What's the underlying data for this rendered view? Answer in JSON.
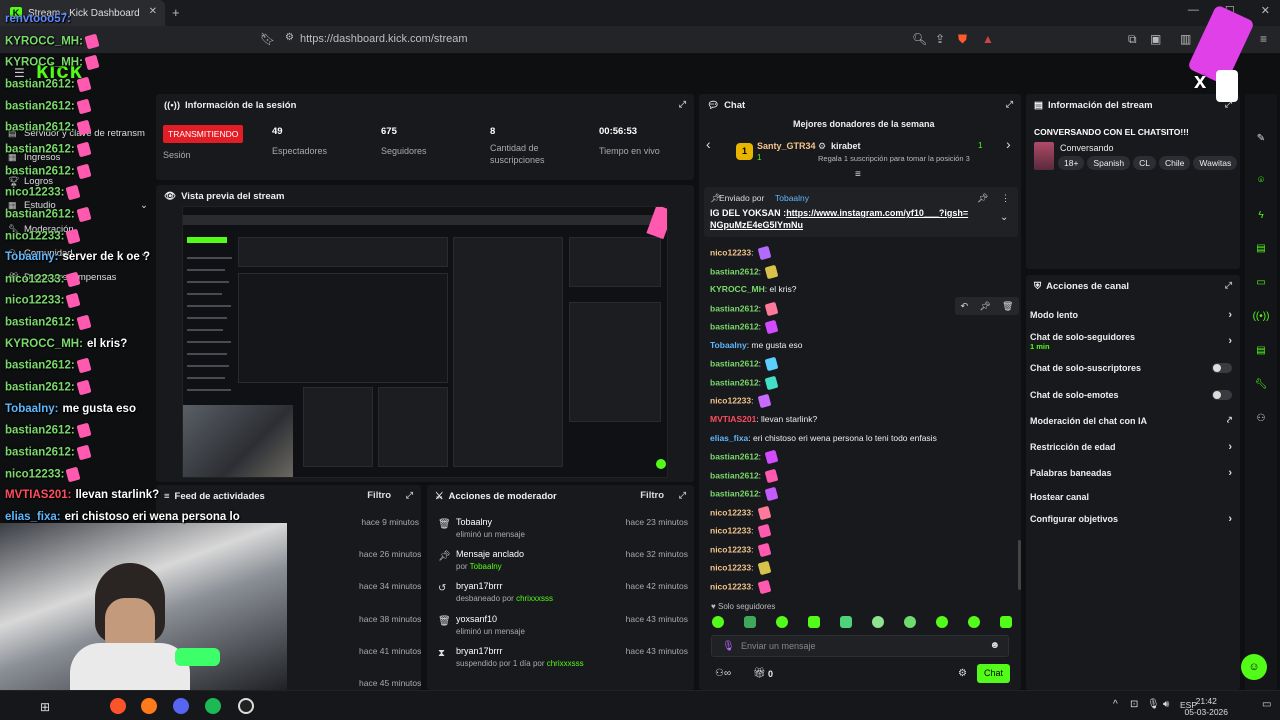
{
  "browser": {
    "tab_title": "Stream - Kick Dashboard",
    "url": "https://dashboard.kick.com/stream"
  },
  "app": {
    "logo": "kick"
  },
  "sidebar": {
    "items": [
      {
        "label": "Servidor y clave de retransm",
        "icon": "server-icon"
      },
      {
        "label": "Ingresos",
        "icon": "dollar-icon"
      },
      {
        "label": "Logros",
        "icon": "trophy-icon"
      },
      {
        "label": "Estudio",
        "icon": "grid-icon"
      },
      {
        "label": "Moderación",
        "icon": "wrench-icon"
      },
      {
        "label": "Comunidad",
        "icon": "people-icon"
      },
      {
        "label": "Drops y recompensas",
        "icon": "gift-icon"
      }
    ]
  },
  "session": {
    "title": "Información de la sesión",
    "status_badge": "TRANSMITIENDO",
    "status_label": "Sesión",
    "stats": [
      {
        "value": "49",
        "label": "Espectadores"
      },
      {
        "value": "675",
        "label": "Seguidores"
      },
      {
        "value": "8",
        "label": "Cantidad de suscripciones"
      },
      {
        "value": "00:56:53",
        "label": "Tiempo en vivo"
      }
    ]
  },
  "preview": {
    "title": "Vista previa del stream"
  },
  "feed": {
    "title": "Feed de actividades",
    "filter": "Filtro",
    "times": [
      "hace 9 minutos",
      "hace 26 minutos",
      "hace 34 minutos",
      "hace 38 minutos",
      "hace 41 minutos",
      "hace 45 minutos"
    ]
  },
  "mod_actions": {
    "title": "Acciones de moderador",
    "filter": "Filtro",
    "rows": [
      {
        "icon": "trash-icon",
        "name": "Tobaalny",
        "desc": "eliminó un mensaje",
        "by": "",
        "time": "hace 23 minutos"
      },
      {
        "icon": "pin-icon",
        "name": "Mensaje anclado",
        "desc": "por ",
        "by": "Tobaalny",
        "time": "hace 32 minutos"
      },
      {
        "icon": "undo-icon",
        "name": "bryan17brrr",
        "desc": "desbaneado por ",
        "by": "chrixxxsss",
        "time": "hace 42 minutos"
      },
      {
        "icon": "trash-icon",
        "name": "yoxsanf10",
        "desc": "eliminó un mensaje",
        "by": "",
        "time": "hace 43 minutos"
      },
      {
        "icon": "hourglass-icon",
        "name": "bryan17brrr",
        "desc": "suspendido por 1 día por ",
        "by": "chrixxxsss",
        "time": "hace 43 minutos"
      }
    ]
  },
  "chat": {
    "title": "Chat",
    "donors_title": "Mejores donadores de la semana",
    "donor1": {
      "name": "Santy_GTR34",
      "rank": "1",
      "amount": "1"
    },
    "donor2": {
      "name": "kirabet",
      "amount": "1",
      "note": "Regala 1 suscripción para tomar la posición 3"
    },
    "pinned": {
      "header": "Enviado por",
      "by": "Tobaalny",
      "text": "IG DEL YOKSAN :",
      "link": "https://www.instagram.com/yf10___?igsh=NGpuMzE4eG5lYmNu"
    },
    "messages": [
      {
        "user": "nico12233",
        "color": "#f3c58d",
        "text": "",
        "emote": "#b36bff"
      },
      {
        "user": "bastian2612",
        "color": "#7ad96b",
        "text": "",
        "emote": "#d9c24a"
      },
      {
        "user": "KYROCC_MH",
        "color": "#7ad96b",
        "text": "el kris?",
        "emote": ""
      },
      {
        "user": "bastian2612",
        "color": "#7ad96b",
        "text": "",
        "emote": "#ff7a9a"
      },
      {
        "user": "bastian2612",
        "color": "#7ad96b",
        "text": "",
        "emote": "#d24bff"
      },
      {
        "user": "Tobaalny",
        "color": "#5fb8ff",
        "text": "me gusta eso",
        "emote": ""
      },
      {
        "user": "bastian2612",
        "color": "#7ad96b",
        "text": "",
        "emote": "#5ad0ff"
      },
      {
        "user": "bastian2612",
        "color": "#7ad96b",
        "text": "",
        "emote": "#43e0c8"
      },
      {
        "user": "nico12233",
        "color": "#f3c58d",
        "text": "",
        "emote": "#c76bff"
      },
      {
        "user": "MVTIAS201",
        "color": "#ff4d5e",
        "text": "llevan starlink?",
        "emote": ""
      },
      {
        "user": "elias_fixa",
        "color": "#5fb8ff",
        "text": "eri chistoso eri wena persona lo teni todo enfasis",
        "emote": ""
      },
      {
        "user": "bastian2612",
        "color": "#7ad96b",
        "text": "",
        "emote": "#d24bff"
      },
      {
        "user": "bastian2612",
        "color": "#7ad96b",
        "text": "",
        "emote": "#ff5ab0"
      },
      {
        "user": "bastian2612",
        "color": "#7ad96b",
        "text": "",
        "emote": "#c45bff"
      },
      {
        "user": "nico12233",
        "color": "#f3c58d",
        "text": "",
        "emote": "#ff7a9a"
      },
      {
        "user": "nico12233",
        "color": "#f3c58d",
        "text": "",
        "emote": "#ff5ab0"
      },
      {
        "user": "nico12233",
        "color": "#f3c58d",
        "text": "",
        "emote": "#ff5ab0"
      },
      {
        "user": "nico12233",
        "color": "#f3c58d",
        "text": "",
        "emote": "#d9c24a"
      },
      {
        "user": "nico12233",
        "color": "#f3c58d",
        "text": "",
        "emote": "#ff5ab0"
      }
    ],
    "followers_only": "Solo seguidores",
    "input_placeholder": "Enviar un mensaje",
    "points": "0",
    "send": "Chat"
  },
  "stream_info": {
    "title": "Información del stream",
    "stream_title": "CONVERSANDO CON EL CHATSITO!!!",
    "category": "Conversando",
    "tags": [
      "18+",
      "Spanish",
      "CL",
      "Chile",
      "Wawitas"
    ]
  },
  "channel_actions": {
    "title": "Acciones de canal",
    "items": [
      {
        "label": "Modo lento",
        "sub": "",
        "kind": "chevron"
      },
      {
        "label": "Chat de solo-seguidores",
        "sub": "1 min",
        "kind": "chevron"
      },
      {
        "label": "Chat de solo-suscriptores",
        "sub": "",
        "kind": "toggle"
      },
      {
        "label": "Chat de solo-emotes",
        "sub": "",
        "kind": "toggle"
      },
      {
        "label": "Moderación del chat con IA",
        "sub": "",
        "kind": "external"
      },
      {
        "label": "Restricción de edad",
        "sub": "",
        "kind": "chevron"
      },
      {
        "label": "Palabras baneadas",
        "sub": "",
        "kind": "chevron"
      },
      {
        "label": "Hostear canal",
        "sub": "",
        "kind": "none"
      },
      {
        "label": "Configurar objetivos",
        "sub": "",
        "kind": "chevron"
      }
    ]
  },
  "overlay_chat": [
    {
      "user": "renvtooo57:",
      "text": "",
      "color": "#5f8bff",
      "emote": ""
    },
    {
      "user": "KYROCC_MH:",
      "text": "",
      "color": "#7ad96b",
      "emote": "#ff5ab0"
    },
    {
      "user": "KYROCC_MH:",
      "text": "",
      "color": "#7ad96b",
      "emote": "#ff5ab0"
    },
    {
      "user": "bastian2612:",
      "text": "",
      "color": "#7ad96b",
      "emote": "#ff5ab0"
    },
    {
      "user": "bastian2612:",
      "text": "",
      "color": "#7ad96b",
      "emote": "#ff5ab0"
    },
    {
      "user": "bastian2612:",
      "text": "",
      "color": "#7ad96b",
      "emote": "#ff5ab0"
    },
    {
      "user": "bastian2612:",
      "text": "",
      "color": "#7ad96b",
      "emote": "#ff5ab0"
    },
    {
      "user": "bastian2612:",
      "text": "",
      "color": "#7ad96b",
      "emote": "#ff5ab0"
    },
    {
      "user": "nico12233:",
      "text": "",
      "color": "#7ad96b",
      "emote": "#ff5ab0"
    },
    {
      "user": "bastian2612:",
      "text": "",
      "color": "#7ad96b",
      "emote": "#ff5ab0"
    },
    {
      "user": "nico12233:",
      "text": "",
      "color": "#7ad96b",
      "emote": "#ff5ab0"
    },
    {
      "user": "Tobaalny:",
      "text": "server de k oe ?",
      "color": "#5fb8ff",
      "emote": ""
    },
    {
      "user": "nico12233:",
      "text": "",
      "color": "#7ad96b",
      "emote": "#ff5ab0"
    },
    {
      "user": "nico12233:",
      "text": "",
      "color": "#7ad96b",
      "emote": "#ff5ab0"
    },
    {
      "user": "bastian2612:",
      "text": "",
      "color": "#7ad96b",
      "emote": "#ff5ab0"
    },
    {
      "user": "KYROCC_MH:",
      "text": "el kris?",
      "color": "#7ad96b",
      "emote": ""
    },
    {
      "user": "bastian2612:",
      "text": "",
      "color": "#7ad96b",
      "emote": "#ff5ab0"
    },
    {
      "user": "bastian2612:",
      "text": "",
      "color": "#7ad96b",
      "emote": "#ff5ab0"
    },
    {
      "user": "Tobaalny:",
      "text": "me gusta eso",
      "color": "#5fb8ff",
      "emote": ""
    },
    {
      "user": "bastian2612:",
      "text": "",
      "color": "#7ad96b",
      "emote": "#ff5ab0"
    },
    {
      "user": "bastian2612:",
      "text": "",
      "color": "#7ad96b",
      "emote": "#ff5ab0"
    },
    {
      "user": "nico12233:",
      "text": "",
      "color": "#7ad96b",
      "emote": "#ff5ab0"
    },
    {
      "user": "MVTIAS201:",
      "text": "llevan starlink?",
      "color": "#ff4d5e",
      "emote": ""
    },
    {
      "user": "elias_fixa:",
      "text": "eri chistoso eri wena persona lo",
      "color": "#5fb8ff",
      "emote": ""
    }
  ],
  "taskbar": {
    "lang": "ESP",
    "time": "21:42",
    "date": "05-03-2026"
  },
  "colors": {
    "accent": "#53fc18",
    "live": "#e31d25",
    "panel": "#18191c"
  }
}
